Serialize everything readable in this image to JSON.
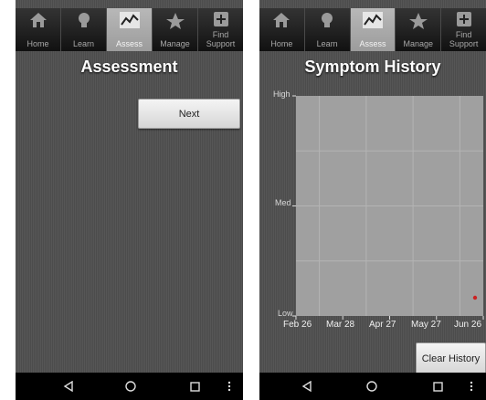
{
  "tabs": [
    {
      "label": "Home",
      "icon": "home-icon",
      "active": false
    },
    {
      "label": "Learn",
      "icon": "lightbulb-icon",
      "active": false
    },
    {
      "label": "Assess",
      "icon": "chart-line-icon",
      "active": true
    },
    {
      "label": "Manage",
      "icon": "star-icon",
      "active": false
    },
    {
      "label": "Find Support",
      "line1": "Find",
      "line2": "Support",
      "icon": "plus-box-icon",
      "active": false
    }
  ],
  "assessment": {
    "title": "Assessment",
    "next_label": "Next"
  },
  "history": {
    "title": "Symptom History",
    "clear_label": "Clear History"
  },
  "chart_data": {
    "type": "scatter",
    "title": "Symptom History",
    "y_levels": [
      "Low",
      "Med",
      "High"
    ],
    "x_ticks": [
      "Feb 26",
      "Mar 28",
      "Apr 27",
      "May 27",
      "Jun 26"
    ],
    "points": [
      {
        "x": "Jun 24",
        "y": "Low",
        "color": "#cc2222"
      }
    ],
    "grid": true
  },
  "colors": {
    "plot_bg": "#a0a0a0",
    "accent_tab": "#a8a8a8"
  }
}
